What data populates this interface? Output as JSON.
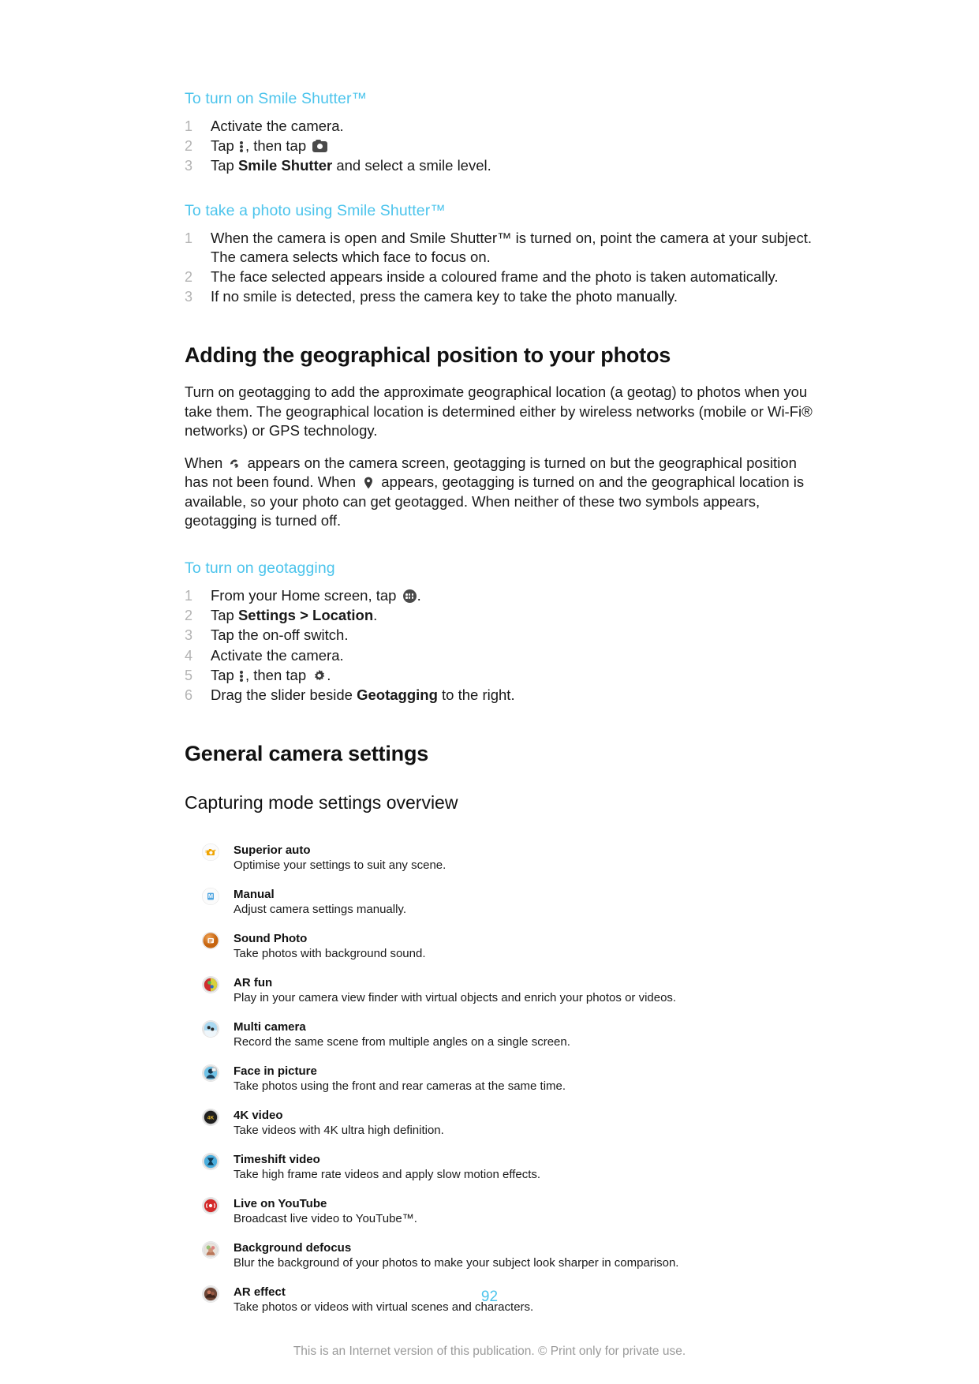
{
  "document": {
    "page_number": "92",
    "footer_note": "This is an Internet version of this publication. © Print only for private use."
  },
  "procedures": [
    {
      "title": "To turn on Smile Shutter™",
      "steps": [
        {
          "parts": [
            {
              "t": "Activate the camera."
            }
          ]
        },
        {
          "parts": [
            {
              "t": "Tap "
            },
            {
              "icon": "more-vertical-icon"
            },
            {
              "t": ", then tap "
            },
            {
              "icon": "camera-icon"
            }
          ]
        },
        {
          "parts": [
            {
              "t": "Tap "
            },
            {
              "t": "Smile Shutter",
              "b": true
            },
            {
              "t": " and select a smile level."
            }
          ]
        }
      ]
    },
    {
      "title": "To take a photo using Smile Shutter™",
      "steps": [
        {
          "parts": [
            {
              "t": "When the camera is open and Smile Shutter™ is turned on, point the camera at your subject. The camera selects which face to focus on."
            }
          ]
        },
        {
          "parts": [
            {
              "t": "The face selected appears inside a coloured frame and the photo is taken automatically."
            }
          ]
        },
        {
          "parts": [
            {
              "t": "If no smile is detected, press the camera key to take the photo manually."
            }
          ]
        }
      ]
    }
  ],
  "geo_section": {
    "heading": "Adding the geographical position to your photos",
    "paragraph1": "Turn on geotagging to add the approximate geographical location (a geotag) to photos when you take them. The geographical location is determined either by wireless networks (mobile or Wi-Fi® networks) or GPS technology.",
    "paragraph2_parts": [
      {
        "t": "When "
      },
      {
        "icon": "geotag-searching-icon"
      },
      {
        "t": " appears on the camera screen, geotagging is turned on but the geographical position has not been found. When "
      },
      {
        "icon": "location-pin-icon"
      },
      {
        "t": " appears, geotagging is turned on and the geographical location is available, so your photo can get geotagged. When neither of these two symbols appears, geotagging is turned off."
      }
    ],
    "procedure": {
      "title": "To turn on geotagging",
      "steps": [
        {
          "parts": [
            {
              "t": "From your Home screen, tap "
            },
            {
              "icon": "app-drawer-icon"
            },
            {
              "t": "."
            }
          ]
        },
        {
          "parts": [
            {
              "t": "Tap "
            },
            {
              "t": "Settings",
              "b": true
            },
            {
              "t": " > "
            },
            {
              "t": "Location",
              "b": true
            },
            {
              "t": "."
            }
          ]
        },
        {
          "parts": [
            {
              "t": "Tap the on-off switch."
            }
          ]
        },
        {
          "parts": [
            {
              "t": "Activate the camera."
            }
          ]
        },
        {
          "parts": [
            {
              "t": "Tap "
            },
            {
              "icon": "more-vertical-icon"
            },
            {
              "t": ", then tap "
            },
            {
              "icon": "gear-icon"
            },
            {
              "t": "."
            }
          ]
        },
        {
          "parts": [
            {
              "t": "Drag the slider beside "
            },
            {
              "t": "Geotagging",
              "b": true
            },
            {
              "t": " to the right."
            }
          ]
        }
      ]
    }
  },
  "general_section": {
    "heading": "General camera settings",
    "subheading": "Capturing mode settings overview",
    "modes": [
      {
        "icon": "superior-auto-icon",
        "name": "Superior auto",
        "description": "Optimise your settings to suit any scene.",
        "color": "#f0a400"
      },
      {
        "icon": "manual-mode-icon",
        "name": "Manual",
        "description": "Adjust camera settings manually.",
        "color": "#3f9fe0"
      },
      {
        "icon": "sound-photo-icon",
        "name": "Sound Photo",
        "description": "Take photos with background sound.",
        "color": "#d9731a"
      },
      {
        "icon": "ar-fun-icon",
        "name": "AR fun",
        "description": "Play in your camera view finder with virtual objects and enrich your photos or videos.",
        "color": "#cf2e2e"
      },
      {
        "icon": "multi-camera-icon",
        "name": "Multi camera",
        "description": "Record the same scene from multiple angles on a single screen.",
        "color": "#9fd3ee"
      },
      {
        "icon": "face-in-picture-icon",
        "name": "Face in picture",
        "description": "Take photos using the front and rear cameras at the same time.",
        "color": "#6fc3e8"
      },
      {
        "icon": "4k-video-icon",
        "name": "4K video",
        "description": "Take videos with 4K ultra high definition.",
        "color": "#2b2b2b"
      },
      {
        "icon": "timeshift-video-icon",
        "name": "Timeshift video",
        "description": "Take high frame rate videos and apply slow motion effects.",
        "color": "#4aaede"
      },
      {
        "icon": "live-on-youtube-icon",
        "name": "Live on YouTube",
        "description": "Broadcast live video to YouTube™.",
        "color": "#d42b2b"
      },
      {
        "icon": "background-defocus-icon",
        "name": "Background defocus",
        "description": "Blur the background of your photos to make your subject look sharper in comparison.",
        "color": "#c99a86"
      },
      {
        "icon": "ar-effect-icon",
        "name": "AR effect",
        "description": "Take photos or videos with virtual scenes and characters.",
        "color": "#8c4a3a"
      }
    ]
  }
}
